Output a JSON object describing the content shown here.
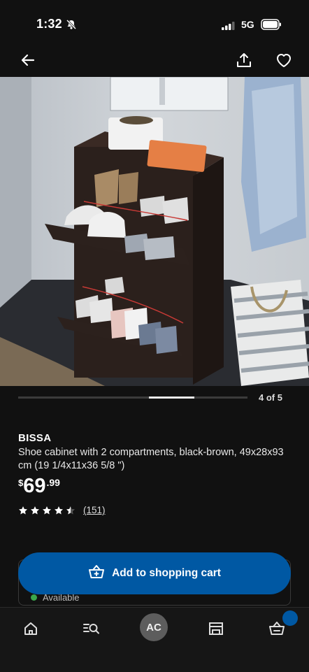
{
  "status_bar": {
    "time": "1:32",
    "network": "5G"
  },
  "gallery": {
    "counter": "4 of 5",
    "position": 4,
    "total": 5
  },
  "product": {
    "brand": "BISSA",
    "description": "Shoe cabinet with 2 compartments, black-brown, 49x28x93 cm (19 1/4x11x36 5/8 \")",
    "price": {
      "currency": "$",
      "dollars": "69",
      "cents": ".99"
    },
    "rating": {
      "stars": 4.5,
      "out_of": 5,
      "count": "(151)"
    }
  },
  "availability": {
    "label": "Available"
  },
  "cart_button": {
    "label": "Add to shopping cart"
  },
  "tabbar": {
    "avatar_initials": "AC"
  },
  "colors": {
    "brand_blue": "#0058a3",
    "available_green": "#3aa64b",
    "background": "#111111"
  }
}
